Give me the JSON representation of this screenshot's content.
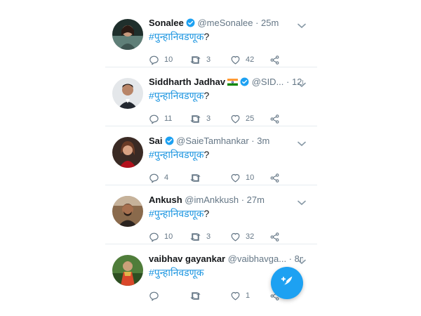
{
  "tweets": [
    {
      "name": "Sonalee",
      "flag": "",
      "verified": true,
      "handle": "@meSonalee",
      "time": "25m",
      "text": "#पुन्हानिवडणूक",
      "suffix": "?",
      "replies": "10",
      "retweets": "3",
      "likes": "42",
      "avatar_colors": [
        "#2b3e3a",
        "#8aa39b"
      ]
    },
    {
      "name": "Siddharth Jadhav",
      "flag": "🇮🇳",
      "verified": true,
      "handle": "@SID...",
      "time": "12m",
      "text": "#पुन्हानिवडणूक",
      "suffix": "?",
      "replies": "11",
      "retweets": "3",
      "likes": "25",
      "avatar_colors": [
        "#dfe3e6",
        "#2a2f36"
      ]
    },
    {
      "name": "Sai",
      "flag": "",
      "verified": true,
      "handle": "@SaieTamhankar",
      "time": "3m",
      "text": "#पुन्हानिवडणूक",
      "suffix": "?",
      "replies": "4",
      "retweets": "",
      "likes": "10",
      "avatar_colors": [
        "#a01822",
        "#6b4a3a"
      ]
    },
    {
      "name": "Ankush",
      "flag": "",
      "verified": false,
      "handle": "@imAnkkush",
      "time": "27m",
      "text": "#पुन्हानिवडणूक",
      "suffix": "?",
      "replies": "10",
      "retweets": "3",
      "likes": "32",
      "avatar_colors": [
        "#6d4c33",
        "#2b2420"
      ]
    },
    {
      "name": "vaibhav gayankar",
      "flag": "",
      "verified": false,
      "handle": "@vaibhavga...",
      "time": "8m",
      "text": "#पुन्हानिवडणूक",
      "suffix": "",
      "replies": "",
      "retweets": "",
      "likes": "1",
      "avatar_colors": [
        "#3d6b2e",
        "#c8a24a"
      ]
    }
  ],
  "colors": {
    "accent": "#1da1f2",
    "hashtag": "#1b95e0",
    "secondary_text": "#657786",
    "divider": "#e6ecf0"
  },
  "icons": {
    "verified": "verified-badge-icon",
    "reply": "reply-icon",
    "retweet": "retweet-icon",
    "like": "heart-icon",
    "share": "share-icon",
    "caret": "chevron-down-icon",
    "compose": "compose-tweet-icon"
  }
}
